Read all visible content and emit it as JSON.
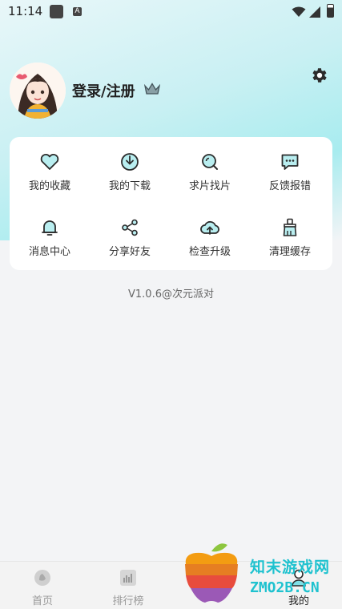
{
  "status_bar": {
    "time": "11:14",
    "badge": "A"
  },
  "header": {
    "login_label": "登录/注册"
  },
  "menu": {
    "items": [
      {
        "label": "我的收藏",
        "icon": "heart-icon"
      },
      {
        "label": "我的下载",
        "icon": "download-icon"
      },
      {
        "label": "求片找片",
        "icon": "search-icon"
      },
      {
        "label": "反馈报错",
        "icon": "feedback-icon"
      },
      {
        "label": "消息中心",
        "icon": "bell-icon"
      },
      {
        "label": "分享好友",
        "icon": "share-icon"
      },
      {
        "label": "检查升级",
        "icon": "cloud-upload-icon"
      },
      {
        "label": "清理缓存",
        "icon": "broom-icon"
      }
    ]
  },
  "version": "V1.0.6@次元派对",
  "tabbar": {
    "tabs": [
      {
        "label": "首页",
        "icon": "home-icon",
        "active": false
      },
      {
        "label": "排行榜",
        "icon": "chart-icon",
        "active": false
      },
      {
        "label": "我的",
        "icon": "user-icon",
        "active": true
      }
    ]
  },
  "watermark": {
    "text": "知末游戏网",
    "sub": "ZMO2B.CN"
  },
  "colors": {
    "accent": "#1fc8d0",
    "icon_dark": "#2b2b2b",
    "bg_gradient": "#a8ecef"
  }
}
